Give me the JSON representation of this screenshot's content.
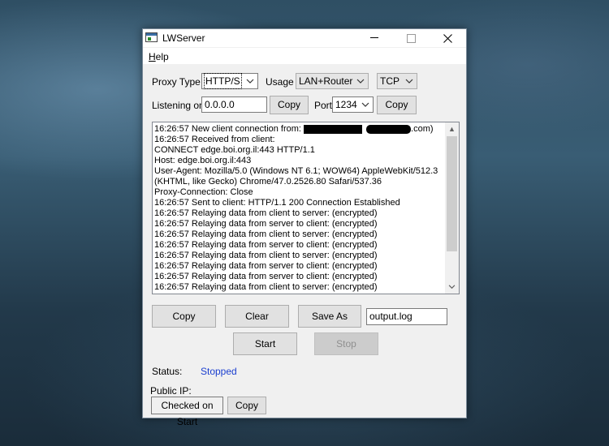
{
  "window": {
    "title": "LWServer"
  },
  "menu": {
    "help": "Help",
    "help_underline": "H",
    "help_rest": "elp"
  },
  "settings": {
    "proxy_type_label": "Proxy Type",
    "proxy_type_value": "HTTP/S",
    "usage_label": "Usage",
    "usage_value": "LAN+Router",
    "protocol_value": "TCP",
    "listening_label": "Listening on",
    "listening_value": "0.0.0.0",
    "copy_address_label": "Copy",
    "port_label": "Port",
    "port_value": "1234",
    "copy_port_label": "Copy"
  },
  "log": {
    "first_prefix": "16:26:57 New client connection from: ",
    "first_suffix": ".com)",
    "lines": [
      "16:26:57 Received from client:",
      "CONNECT edge.boi.org.il:443 HTTP/1.1",
      "Host: edge.boi.org.il:443",
      "User-Agent: Mozilla/5.0 (Windows NT 6.1; WOW64) AppleWebKit/512.3",
      "(KHTML, like Gecko) Chrome/47.0.2526.80 Safari/537.36",
      "Proxy-Connection: Close",
      "16:26:57 Sent to client: HTTP/1.1 200 Connection Established",
      "16:26:57 Relaying data from client to server: (encrypted)",
      "16:26:57 Relaying data from server to client: (encrypted)",
      "16:26:57 Relaying data from client to server: (encrypted)",
      "16:26:57 Relaying data from server to client: (encrypted)",
      "16:26:57 Relaying data from client to server: (encrypted)",
      "16:26:57 Relaying data from server to client: (encrypted)",
      "16:26:57 Relaying data from server to client: (encrypted)",
      "16:26:57 Relaying data from client to server: (encrypted)"
    ]
  },
  "actions": {
    "copy_label": "Copy",
    "clear_label": "Clear",
    "save_as_label": "Save As",
    "filename_value": "output.log",
    "start_label": "Start",
    "stop_label": "Stop"
  },
  "status": {
    "label": "Status:",
    "value": "Stopped",
    "value_color": "#1a3ecf",
    "public_ip_label": "Public IP:",
    "checked_label": "Checked on Start",
    "copy_ip_label": "Copy"
  },
  "icons": {
    "minimize": "minimize-icon",
    "maximize": "maximize-icon",
    "close": "close-icon",
    "dropdown": "chevron-down-icon",
    "scroll_up": "scroll-up-icon",
    "scroll_down": "scroll-down-icon"
  }
}
